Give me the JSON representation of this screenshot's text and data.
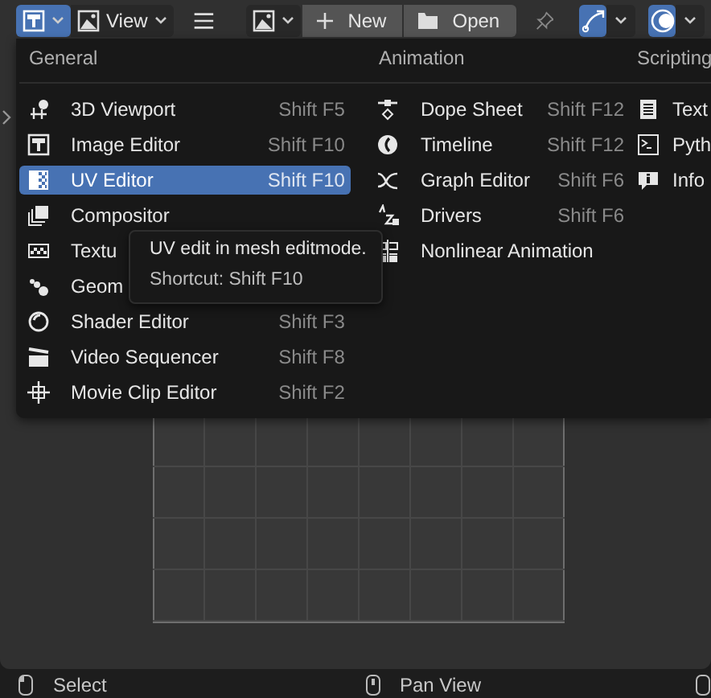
{
  "header": {
    "view_menu": "View",
    "new_button": "New",
    "open_button": "Open"
  },
  "menu": {
    "columns": [
      {
        "heading": "General",
        "items": [
          {
            "label": "3D Viewport",
            "shortcut": "Shift F5",
            "selected": false
          },
          {
            "label": "Image Editor",
            "shortcut": "Shift F10",
            "selected": false
          },
          {
            "label": "UV Editor",
            "shortcut": "Shift F10",
            "selected": true
          },
          {
            "label": "Compositor",
            "selected": false
          },
          {
            "label": "Textu",
            "selected": false
          },
          {
            "label": "Geom",
            "selected": false
          },
          {
            "label": "Shader Editor",
            "shortcut": "Shift F3",
            "selected": false
          },
          {
            "label": "Video Sequencer",
            "shortcut": "Shift F8",
            "selected": false
          },
          {
            "label": "Movie Clip Editor",
            "shortcut": "Shift F2",
            "selected": false
          }
        ]
      },
      {
        "heading": "Animation",
        "items": [
          {
            "label": "Dope Sheet",
            "shortcut": "Shift F12",
            "selected": false
          },
          {
            "label": "Timeline",
            "shortcut": "Shift F12",
            "selected": false
          },
          {
            "label": "Graph Editor",
            "shortcut": "Shift F6",
            "selected": false
          },
          {
            "label": "Drivers",
            "shortcut": "Shift F6",
            "selected": false
          },
          {
            "label": "Nonlinear Animation",
            "selected": false
          }
        ]
      },
      {
        "heading": "Scripting",
        "items": [
          {
            "label": "Text",
            "selected": false
          },
          {
            "label": "Pyth",
            "selected": false
          },
          {
            "label": "Info",
            "selected": false
          }
        ]
      }
    ]
  },
  "tooltip": {
    "lines": [
      "UV edit in mesh editmode.",
      "Shortcut: Shift F10"
    ]
  },
  "status_bar": [
    {
      "label": "Select"
    },
    {
      "label": "Pan View"
    }
  ]
}
